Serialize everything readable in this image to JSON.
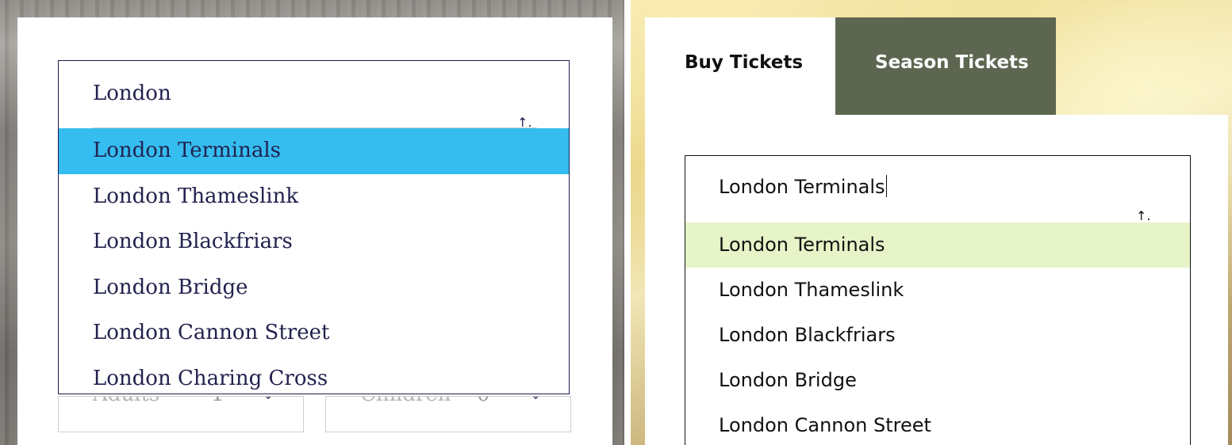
{
  "left": {
    "input_value": "London",
    "arrow_glyph": "↑.",
    "suggestions": [
      {
        "label": "London Terminals",
        "active": true
      },
      {
        "label": "London Thameslink",
        "active": false
      },
      {
        "label": "London Blackfriars",
        "active": false
      },
      {
        "label": "London Bridge",
        "active": false
      },
      {
        "label": "London Cannon Street",
        "active": false
      },
      {
        "label": "London Charing Cross",
        "active": false
      }
    ],
    "highlight_color": "#35bdf0",
    "adults": {
      "label": "Adults",
      "value": "1",
      "chevron": "⌄"
    },
    "children": {
      "label": "Children",
      "value": "0",
      "chevron": "⌄"
    }
  },
  "right": {
    "tabs": {
      "buy": "Buy Tickets",
      "season": "Season Tickets"
    },
    "input_value": "London Terminals",
    "arrow_glyph": "↑.",
    "suggestions": [
      {
        "label": "London Terminals",
        "active": true
      },
      {
        "label": "London Thameslink",
        "active": false
      },
      {
        "label": "London Blackfriars",
        "active": false
      },
      {
        "label": "London Bridge",
        "active": false
      },
      {
        "label": "London Cannon Street",
        "active": false
      }
    ],
    "highlight_color": "#e6f4c7"
  },
  "icons": {
    "sort_arrow": "arrow-up-icon",
    "chevron": "chevron-down-icon"
  }
}
